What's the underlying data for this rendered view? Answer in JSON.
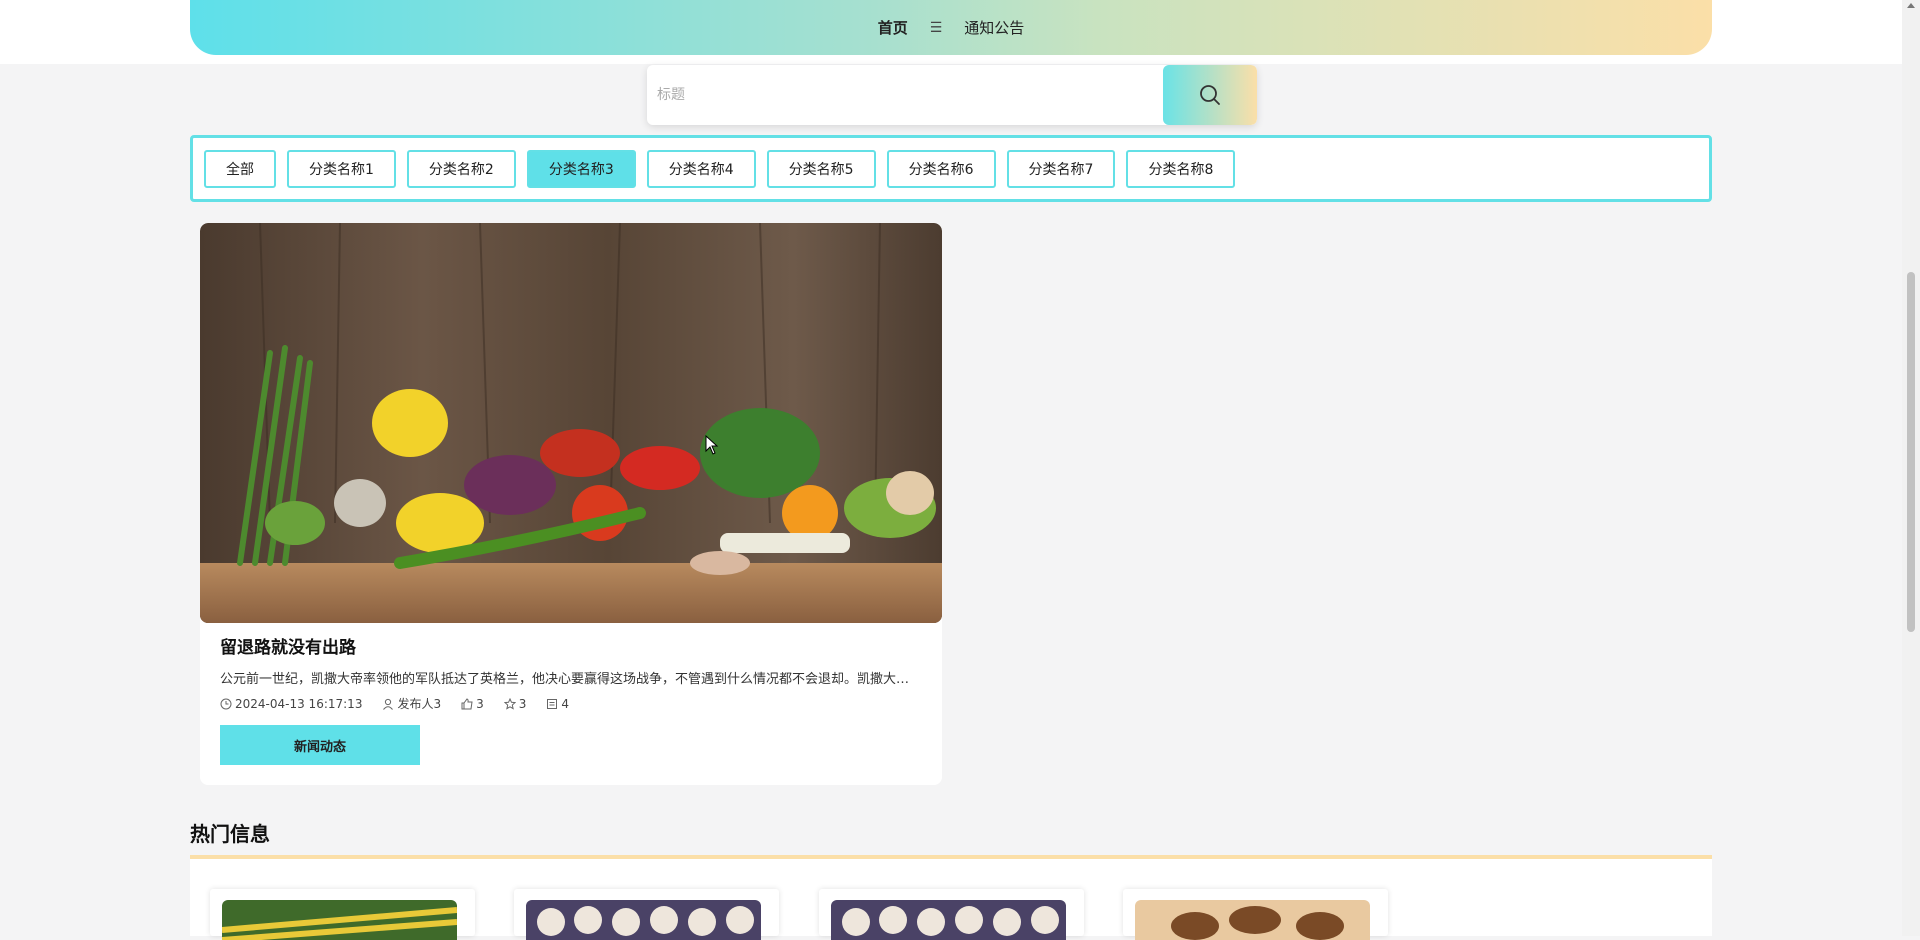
{
  "nav": {
    "home": "首页",
    "separator": "☰",
    "notice": "通知公告"
  },
  "search": {
    "placeholder": "标题"
  },
  "categories": [
    {
      "label": "全部",
      "active": false
    },
    {
      "label": "分类名称1",
      "active": false
    },
    {
      "label": "分类名称2",
      "active": false
    },
    {
      "label": "分类名称3",
      "active": true
    },
    {
      "label": "分类名称4",
      "active": false
    },
    {
      "label": "分类名称5",
      "active": false
    },
    {
      "label": "分类名称6",
      "active": false
    },
    {
      "label": "分类名称7",
      "active": false
    },
    {
      "label": "分类名称8",
      "active": false
    }
  ],
  "article": {
    "title": "留退路就没有出路",
    "description": "公元前一世纪，凯撒大帝率领他的军队抵达了英格兰，他决心要赢得这场战争，不管遇到什么情况都不会退却。凯撒大帝命令手下将所有的船只焚毁",
    "date": "2024-04-13 16:17:13",
    "author": "发布人3",
    "likes": "3",
    "favorites": "3",
    "comments": "4",
    "tag": "新闻动态"
  },
  "hot": {
    "title": "热门信息"
  },
  "colors": {
    "accent": "#5fe0e8",
    "gradient_end": "#fbdfa8"
  }
}
